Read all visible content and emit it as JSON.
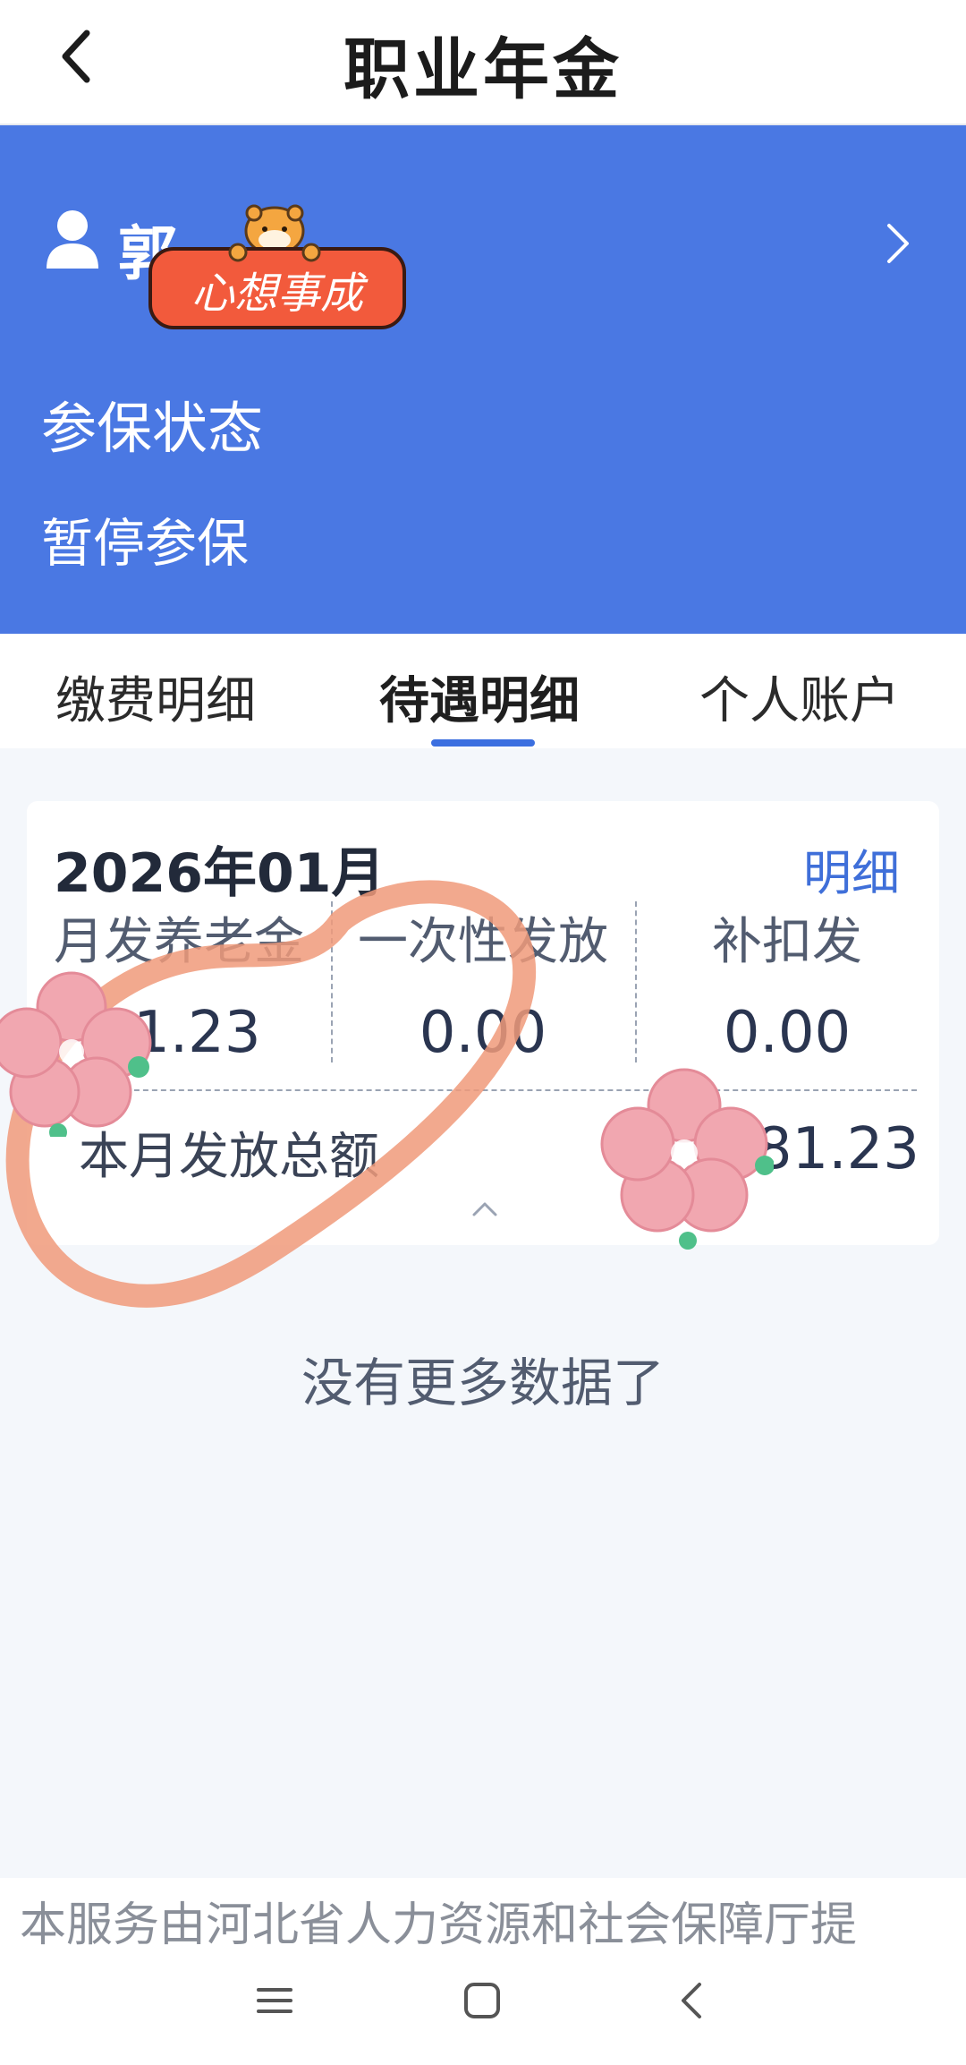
{
  "header": {
    "title": "职业年金",
    "back_icon": "chevron-left-icon"
  },
  "profile": {
    "name_visible": "郭",
    "sticker_text": "心想事成",
    "status_label": "参保状态",
    "status_value": "暂停参保"
  },
  "tabs": [
    {
      "label": "缴费明细",
      "active": false
    },
    {
      "label": "待遇明细",
      "active": true
    },
    {
      "label": "个人账户",
      "active": false
    }
  ],
  "card": {
    "date": "2026年01月",
    "detail_link": "明细",
    "columns": [
      {
        "label": "月发养老金",
        "value": "31.23"
      },
      {
        "label": "一次性发放",
        "value": "0.00"
      },
      {
        "label": "补扣发",
        "value": "0.00"
      }
    ],
    "total_label": "本月发放总额",
    "total_value": "81.23"
  },
  "empty_message": "没有更多数据了",
  "footer": {
    "text": "本服务由河北省人力资源和社会保障厅提"
  },
  "colors": {
    "primary": "#4a78e3",
    "accent": "#3f6fd9",
    "background": "#f4f7fb"
  }
}
